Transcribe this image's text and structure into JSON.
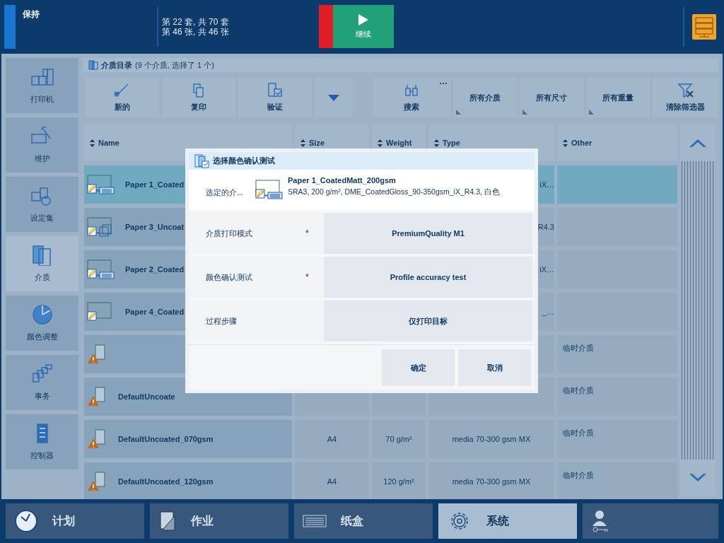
{
  "status_bar": {
    "state": "保持",
    "progress": [
      "第 22 套, 共 70 套",
      "第 46 张, 共 46 张"
    ],
    "continue_button": "继续"
  },
  "sidebar": {
    "items": [
      {
        "label": "打印机",
        "selected": false
      },
      {
        "label": "维护",
        "selected": false
      },
      {
        "label": "设定集",
        "selected": false
      },
      {
        "label": "介质",
        "selected": true
      },
      {
        "label": "颜色调整",
        "selected": false
      },
      {
        "label": "事务",
        "selected": false
      },
      {
        "label": "控制器",
        "selected": false
      }
    ]
  },
  "catalog": {
    "title": "介质目录",
    "summary": "(9 个介质, 选择了 1 个)"
  },
  "toolbar": [
    {
      "kind": "action",
      "label": "新的"
    },
    {
      "kind": "action",
      "label": "复印"
    },
    {
      "kind": "action",
      "label": "验证"
    },
    {
      "kind": "dropdown"
    },
    {
      "kind": "search",
      "label": "搜索",
      "more": "…"
    },
    {
      "kind": "filter",
      "label": "所有介质"
    },
    {
      "kind": "filter",
      "label": "所有尺寸"
    },
    {
      "kind": "filter",
      "label": "所有重量"
    },
    {
      "kind": "clear",
      "label": "清除筛选器"
    }
  ],
  "table": {
    "columns": [
      "Name",
      "Size",
      "Weight",
      "Type",
      "Other"
    ],
    "rows": [
      {
        "kind": "coated_list",
        "name": "Paper 1_Coated",
        "type": "iX…",
        "selected": true
      },
      {
        "kind": "coated_stack",
        "name": "Paper 3_Uncoat",
        "type": "R4.3",
        "selected": false
      },
      {
        "kind": "coated_list",
        "name": "Paper 2_Coated",
        "type": "iX…",
        "selected": false
      },
      {
        "kind": "coated",
        "name": "Paper 4_Coated",
        "type": "_…",
        "selected": false
      },
      {
        "kind": "warning",
        "other": "临时介质",
        "selected": false
      },
      {
        "kind": "warning",
        "name": "DefaultUncoate",
        "other": "临时介质",
        "selected": false
      },
      {
        "kind": "warning",
        "name": "DefaultUncoated_070gsm",
        "size": "A4",
        "weight": "70 g/m²",
        "type": "media 70-300 gsm MX",
        "other": "临时介质",
        "selected": false
      },
      {
        "kind": "warning",
        "name": "DefaultUncoated_120gsm",
        "size": "A4",
        "weight": "120 g/m²",
        "type": "media 70-300 gsm MX",
        "other": "临时介质",
        "selected": false
      }
    ]
  },
  "dialog": {
    "title": "选择颜色确认测试",
    "selected_media": {
      "label": "选定的介...",
      "name": "Paper 1_CoatedMatt_200gsm",
      "details": "SRA3, 200 g/m², DME_CoatedGloss_90-350gsm_iX_R4.3, 白色"
    },
    "fields": [
      {
        "label": "介质打印模式",
        "required_mark": "*",
        "value": "PremiumQuality M1"
      },
      {
        "label": "颜色确认测试",
        "required_mark": "*",
        "value": "Profile accuracy test"
      },
      {
        "label": "过程步骤",
        "value": "仅打印目标"
      }
    ],
    "buttons": [
      "确定",
      "取消"
    ]
  },
  "bottom_nav": [
    {
      "label": "计划",
      "selected": false
    },
    {
      "label": "作业",
      "selected": false
    },
    {
      "label": "纸盒",
      "selected": false
    },
    {
      "label": "系统",
      "selected": true
    },
    {
      "kind": "user",
      "selected": false
    }
  ]
}
